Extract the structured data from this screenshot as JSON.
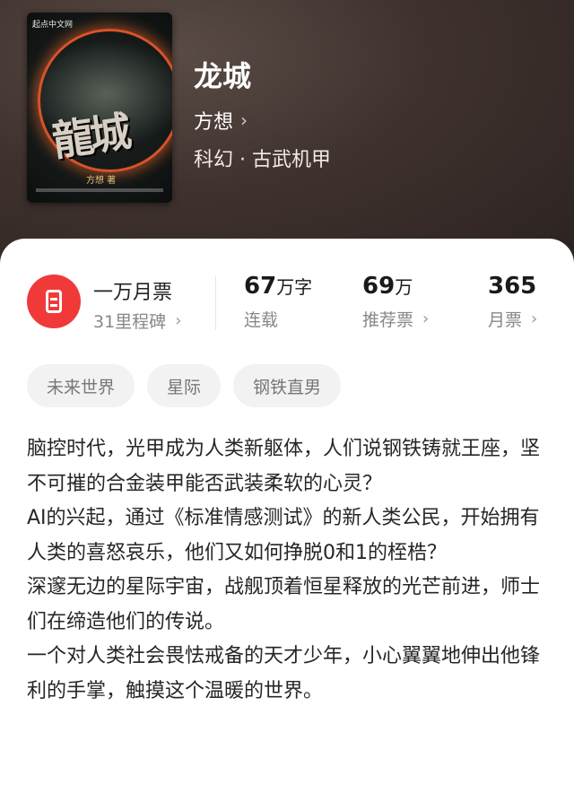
{
  "cover": {
    "publisher": "起点中文网",
    "title": "龍城",
    "author": "方想 著"
  },
  "book": {
    "title": "龙城",
    "author": "方想",
    "genre": "科幻 · 古武机甲"
  },
  "rank": {
    "title": "一万月票",
    "subtitle": "31里程碑"
  },
  "stats": [
    {
      "value": "67",
      "unit": "万字",
      "label": "连载"
    },
    {
      "value": "69",
      "unit": "万",
      "label": "推荐票"
    },
    {
      "value": "365",
      "unit": "",
      "label": "月票"
    }
  ],
  "tags": [
    "未来世界",
    "星际",
    "钢铁直男"
  ],
  "synopsis": [
    "脑控时代，光甲成为人类新躯体，人们说钢铁铸就王座，坚不可摧的合金装甲能否武装柔软的心灵？",
    "AI的兴起，通过《标准情感测试》的新人类公民，开始拥有人类的喜怒哀乐，他们又如何挣脱0和1的桎梏？",
    "深邃无边的星际宇宙，战舰顶着恒星释放的光芒前进，师士们在缔造他们的传说。",
    "一个对人类社会畏怯戒备的天才少年，小心翼翼地伸出他锋利的手掌，触摸这个温暖的世界。"
  ],
  "icons": {
    "author_chevron": "chevron-right-icon",
    "badge": "ticket-icon"
  },
  "colors": {
    "badge": "#f03a3a",
    "hero_bg": "#3f322e"
  }
}
